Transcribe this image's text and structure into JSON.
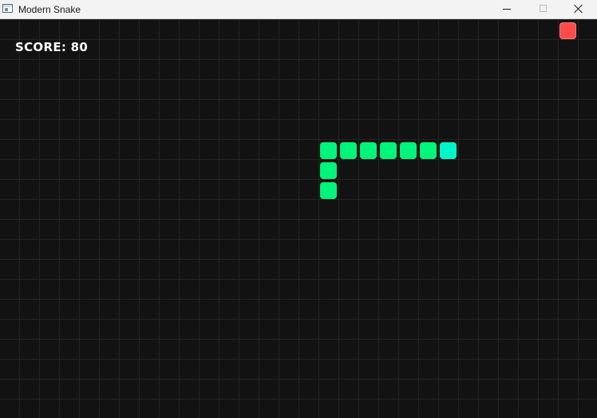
{
  "window": {
    "title": "Modern Snake",
    "icon": "app-window-icon",
    "controls": [
      "minimize",
      "maximize",
      "close"
    ]
  },
  "hud": {
    "score_text": "SCORE: 80"
  },
  "grid": {
    "cell_size_px": 25,
    "visible_columns": 30,
    "visible_rows": 20
  },
  "snake": {
    "direction": "right",
    "head": {
      "col": 22,
      "row": 6
    },
    "body": [
      {
        "col": 21,
        "row": 6
      },
      {
        "col": 20,
        "row": 6
      },
      {
        "col": 19,
        "row": 6
      },
      {
        "col": 18,
        "row": 6
      },
      {
        "col": 17,
        "row": 6
      },
      {
        "col": 16,
        "row": 6
      },
      {
        "col": 16,
        "row": 7
      },
      {
        "col": 16,
        "row": 8
      }
    ],
    "length": 9
  },
  "food": {
    "col": 28,
    "row": 0
  },
  "colors": {
    "background": "#121212",
    "grid_line": "#242424",
    "snake_body": "#00f57a",
    "snake_head": "#00f5c8",
    "food": "#ff4a4a",
    "score_text": "#ffffff"
  }
}
